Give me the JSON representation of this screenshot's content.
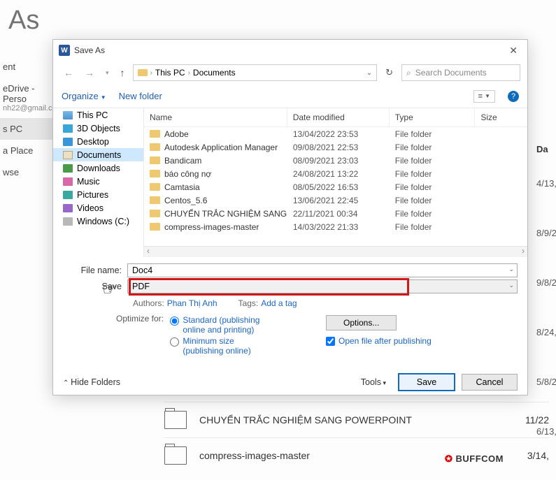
{
  "bg": {
    "header": "As",
    "left": [
      "ent",
      "eDrive - Perso",
      "nh22@gmail.c",
      "s PC",
      "a Place",
      "wse"
    ],
    "right_header": "Da",
    "right_dates": [
      "4/13,",
      "8/9/2",
      "9/8/2",
      "8/24,",
      "5/8/2",
      "6/13,"
    ],
    "rows": [
      {
        "name": "CHUYỂN TRẮC NGHIỆM SANG POWERPOINT",
        "date": "11/22"
      },
      {
        "name": "compress-images-master",
        "date": "3/14,"
      }
    ],
    "watermark": "BUFFCOM"
  },
  "dialog": {
    "title": "Save As",
    "breadcrumb": [
      "This PC",
      "Documents"
    ],
    "search_placeholder": "Search Documents",
    "toolbar": {
      "organize": "Organize",
      "new_folder": "New folder"
    },
    "tree": [
      {
        "label": "This PC",
        "icon": "ic-pc"
      },
      {
        "label": "3D Objects",
        "icon": "ic-3d"
      },
      {
        "label": "Desktop",
        "icon": "ic-desktop"
      },
      {
        "label": "Documents",
        "icon": "ic-docs",
        "selected": true
      },
      {
        "label": "Downloads",
        "icon": "ic-dl"
      },
      {
        "label": "Music",
        "icon": "ic-music"
      },
      {
        "label": "Pictures",
        "icon": "ic-pics"
      },
      {
        "label": "Videos",
        "icon": "ic-vid"
      },
      {
        "label": "Windows (C:)",
        "icon": "ic-drive"
      }
    ],
    "columns": {
      "name": "Name",
      "date": "Date modified",
      "type": "Type",
      "size": "Size"
    },
    "files": [
      {
        "name": "Adobe",
        "date": "13/04/2022 23:53",
        "type": "File folder"
      },
      {
        "name": "Autodesk Application Manager",
        "date": "09/08/2021 22:53",
        "type": "File folder"
      },
      {
        "name": "Bandicam",
        "date": "08/09/2021 23:03",
        "type": "File folder"
      },
      {
        "name": "báo công nợ",
        "date": "24/08/2021 13:22",
        "type": "File folder"
      },
      {
        "name": "Camtasia",
        "date": "08/05/2022 16:53",
        "type": "File folder"
      },
      {
        "name": "Centos_5.6",
        "date": "13/06/2021 22:45",
        "type": "File folder"
      },
      {
        "name": "CHUYỂN TRẮC NGHIỆM SANG POWERP...",
        "date": "22/11/2021 00:34",
        "type": "File folder"
      },
      {
        "name": "compress-images-master",
        "date": "14/03/2022 21:33",
        "type": "File folder"
      }
    ],
    "file_name_label": "File name:",
    "file_name": "Doc4",
    "save_as_label": "Save",
    "save_as_type": "PDF",
    "authors_label": "Authors:",
    "authors": "Phan Thị Anh",
    "tags_label": "Tags:",
    "tags": "Add a tag",
    "optimize_label": "Optimize for:",
    "opt_standard": "Standard (publishing online and printing)",
    "opt_min": "Minimum size (publishing online)",
    "options_btn": "Options...",
    "open_after": "Open file after publishing",
    "hide_folders": "Hide Folders",
    "tools": "Tools",
    "save_btn": "Save",
    "cancel_btn": "Cancel"
  }
}
